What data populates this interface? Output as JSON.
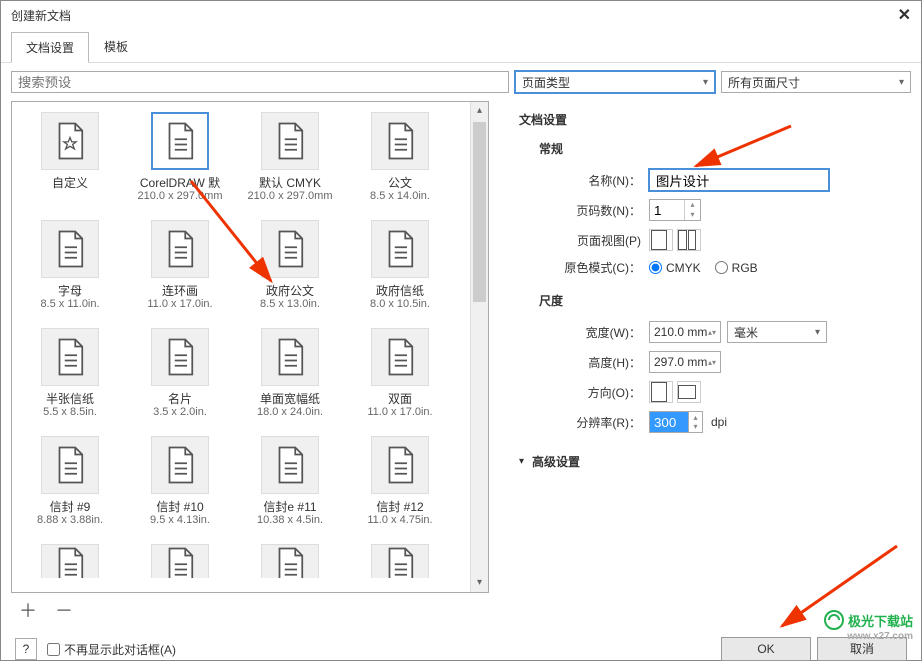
{
  "window": {
    "title": "创建新文档"
  },
  "tabs": {
    "doc_settings": "文档设置",
    "template": "模板"
  },
  "search_placeholder": "搜索预设",
  "page_type_dd": "页面类型",
  "all_sizes_dd": "所有页面尺寸",
  "presets": [
    {
      "label": "自定义",
      "dims": "",
      "icon": "star"
    },
    {
      "label": "CorelDRAW 默",
      "dims": "210.0 x 297.0mm",
      "icon": "doc",
      "selected": true
    },
    {
      "label": "默认 CMYK",
      "dims": "210.0 x 297.0mm",
      "icon": "doc"
    },
    {
      "label": "公文",
      "dims": "8.5 x 14.0in.",
      "icon": "doc"
    },
    {
      "label": "字母",
      "dims": "8.5 x 11.0in.",
      "icon": "doc"
    },
    {
      "label": "连环画",
      "dims": "11.0 x 17.0in.",
      "icon": "doc"
    },
    {
      "label": "政府公文",
      "dims": "8.5 x 13.0in.",
      "icon": "doc"
    },
    {
      "label": "政府信纸",
      "dims": "8.0 x 10.5in.",
      "icon": "doc"
    },
    {
      "label": "半张信纸",
      "dims": "5.5 x 8.5in.",
      "icon": "doc"
    },
    {
      "label": "名片",
      "dims": "3.5 x 2.0in.",
      "icon": "doc"
    },
    {
      "label": "单面宽幅纸",
      "dims": "18.0 x 24.0in.",
      "icon": "doc"
    },
    {
      "label": "双面",
      "dims": "11.0 x 17.0in.",
      "icon": "doc"
    },
    {
      "label": "信封 #9",
      "dims": "8.88 x 3.88in.",
      "icon": "doc"
    },
    {
      "label": "信封 #10",
      "dims": "9.5 x 4.13in.",
      "icon": "doc"
    },
    {
      "label": "信封e #11",
      "dims": "10.38 x 4.5in.",
      "icon": "doc"
    },
    {
      "label": "信封 #12",
      "dims": "11.0 x 4.75in.",
      "icon": "doc"
    }
  ],
  "settings": {
    "title": "文档设置",
    "general": "常规",
    "name_label": "名称(N)：",
    "name_value": "图片设计",
    "pages_label": "页码数(N)：",
    "pages_value": "1",
    "view_label": "页面视图(P)",
    "color_mode_label": "原色模式(C)：",
    "cmyk": "CMYK",
    "rgb": "RGB",
    "dimensions": "尺度",
    "width_label": "宽度(W)：",
    "width_value": "210.0 mm",
    "unit": "毫米",
    "height_label": "高度(H)：",
    "height_value": "297.0 mm",
    "orientation_label": "方向(O)：",
    "resolution_label": "分辨率(R)：",
    "resolution_value": "300",
    "dpi": "dpi",
    "advanced": "高级设置"
  },
  "footer": {
    "dont_show": "不再显示此对话框(A)",
    "ok": "OK",
    "cancel": "取消"
  },
  "watermark": {
    "main": "极光下载站",
    "sub": "www.x27.com"
  }
}
